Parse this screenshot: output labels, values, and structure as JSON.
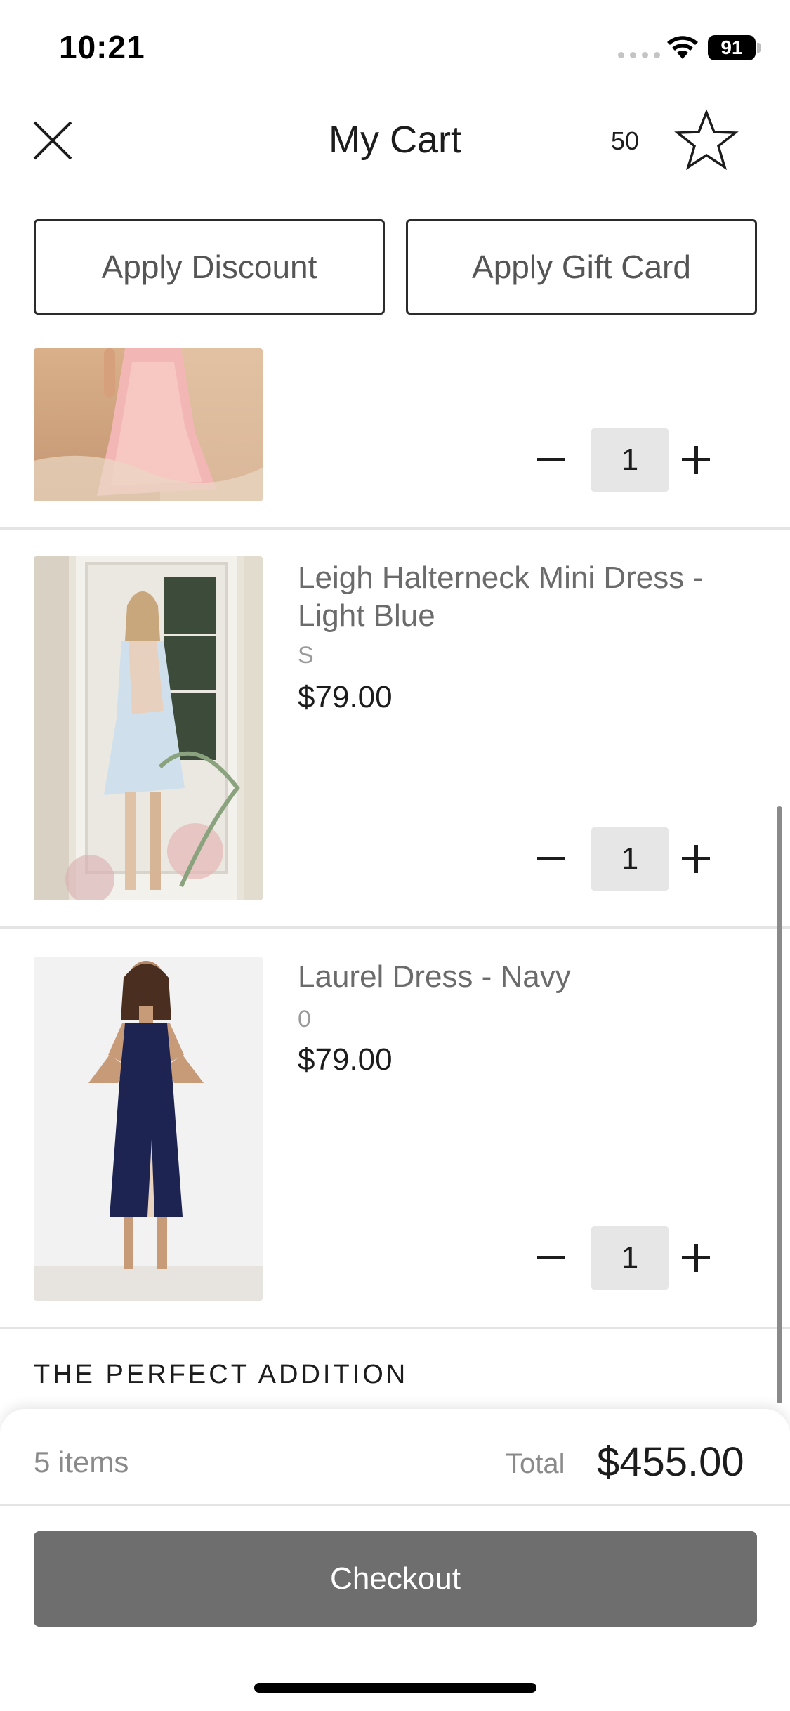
{
  "status_bar": {
    "time": "10:21",
    "battery": "91"
  },
  "header": {
    "title": "My Cart",
    "points": "50",
    "icons": {
      "close": "close-icon",
      "favorite": "star-icon"
    }
  },
  "actions": {
    "discount": "Apply Discount",
    "gift_card": "Apply Gift Card"
  },
  "cart": {
    "items": [
      {
        "name": "",
        "size": "",
        "price": "",
        "quantity": "1",
        "image": "pink tulle dress on beach"
      },
      {
        "name": "Leigh Halterneck Mini Dress - Light Blue",
        "size": "S",
        "price": "$79.00",
        "quantity": "1",
        "image": "light blue halterneck mini dress"
      },
      {
        "name": "Laurel Dress - Navy",
        "size": "0",
        "price": "$79.00",
        "quantity": "1",
        "image": "navy midi dress"
      }
    ]
  },
  "section": {
    "title": "THE PERFECT ADDITION"
  },
  "summary": {
    "items_count": "5 items",
    "total_label": "Total",
    "total_value": "$455.00",
    "checkout_label": "Checkout"
  },
  "colors": {
    "checkout_bg": "#6e6e6e",
    "qty_bg": "#e6e6e6",
    "divider": "#e4e4e4"
  }
}
